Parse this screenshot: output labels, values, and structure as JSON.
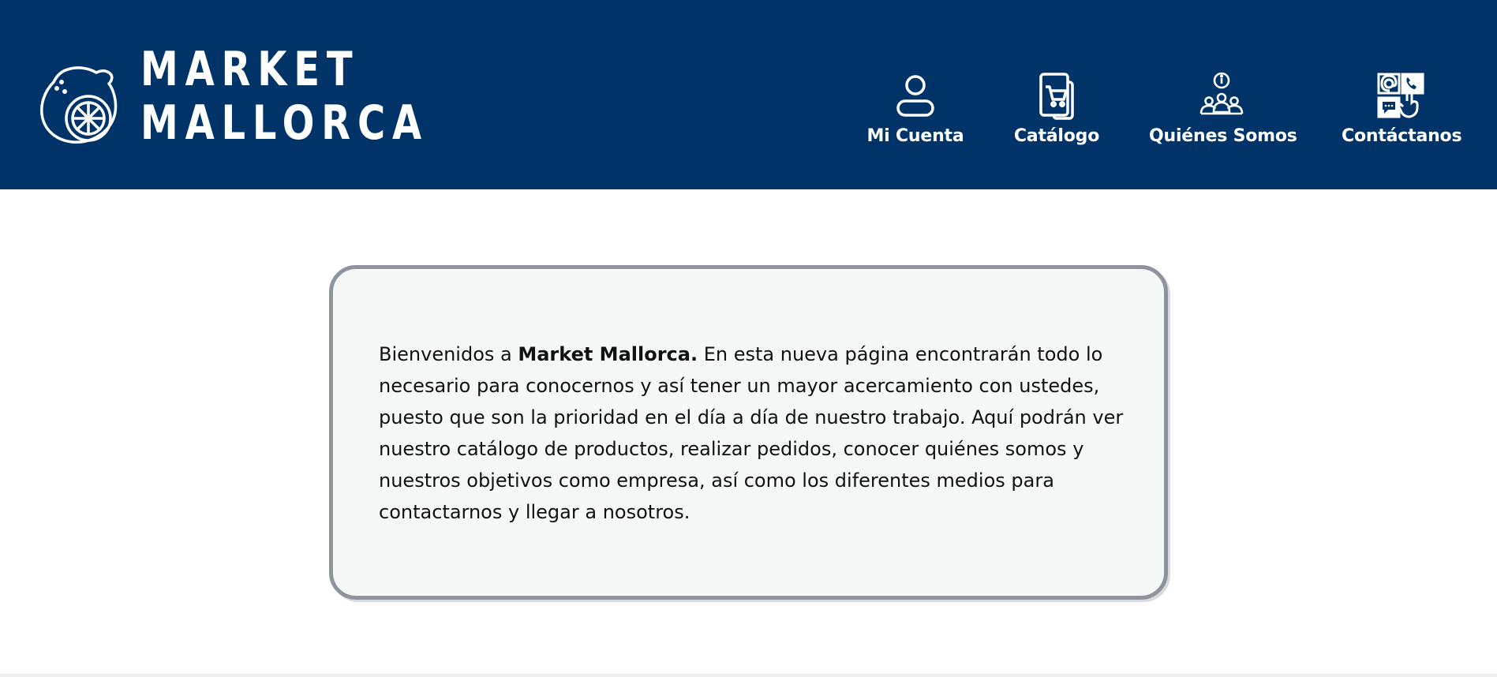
{
  "header": {
    "brand_line1": "MARKET",
    "brand_line2": "MALLORCA",
    "logo_icon": "lemon-icon",
    "background_color": "#003469"
  },
  "nav": [
    {
      "label": "Mi Cuenta",
      "icon": "user-icon"
    },
    {
      "label": "Catálogo",
      "icon": "cart-catalog-icon"
    },
    {
      "label": "Quiénes Somos",
      "icon": "team-info-icon"
    },
    {
      "label": "Contáctanos",
      "icon": "contact-icon"
    }
  ],
  "welcome": {
    "intro": "Bienvenidos a ",
    "brand_bold": "Market Mallorca.",
    "body": " En esta nueva página encontrarán todo lo necesario para conocernos y así tener un mayor acercamiento con ustedes, puesto que son la prioridad en el día a día de nuestro trabajo. Aquí podrán ver nuestro catálogo de productos, realizar pedidos, conocer quiénes somos y nuestros objetivos como empresa, así como los diferentes medios para contactarnos y llegar a nosotros."
  }
}
